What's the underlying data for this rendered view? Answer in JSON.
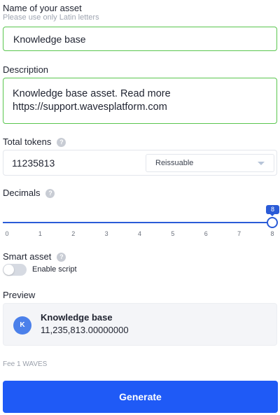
{
  "asset_name": {
    "label": "Name of your asset",
    "hint": "Please use only Latin letters",
    "value": "Knowledge base"
  },
  "description": {
    "label": "Description",
    "line1": "Knowledge base asset. Read more",
    "line2": "https://support.wavesplatform.com"
  },
  "total_tokens": {
    "label": "Total tokens",
    "help_icon": "question-icon",
    "value": "11235813",
    "select_value": "Reissuable"
  },
  "decimals": {
    "label": "Decimals",
    "help_icon": "question-icon",
    "value": 8,
    "value_label": "8",
    "min": 0,
    "max": 8,
    "ticks": [
      "0",
      "1",
      "2",
      "3",
      "4",
      "5",
      "6",
      "7",
      "8"
    ]
  },
  "smart_asset": {
    "label": "Smart asset",
    "help_icon": "question-icon",
    "toggle_label": "Enable script",
    "enabled": false
  },
  "preview": {
    "label": "Preview",
    "avatar_letter": "K",
    "name": "Knowledge base",
    "amount": "11,235,813.00000000"
  },
  "fee": "Fee 1 WAVES",
  "generate_label": "Generate",
  "colors": {
    "accent": "#1f5af6",
    "slider": "#2a5bd7",
    "valid_border": "#5ac64f",
    "avatar": "#4b80ea"
  }
}
